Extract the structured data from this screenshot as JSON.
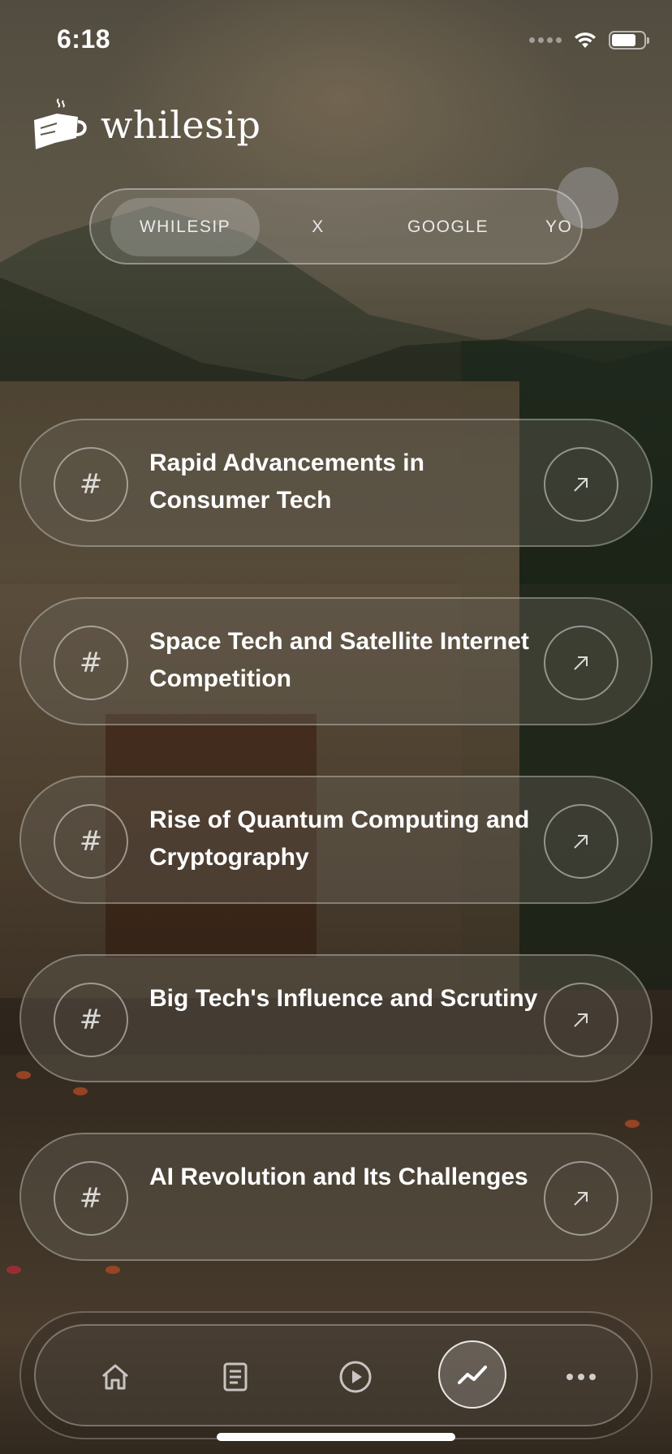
{
  "status_bar": {
    "time": "6:18",
    "battery_level": 0.75
  },
  "app": {
    "name": "whilesip"
  },
  "source_tabs": [
    {
      "label": "WHILESIP",
      "active": true
    },
    {
      "label": "X",
      "active": false
    },
    {
      "label": "GOOGLE",
      "active": false
    },
    {
      "label": "YO",
      "active": false
    }
  ],
  "topics": [
    {
      "title": "Rapid Advancements in Consumer Tech",
      "icon": "hash-icon",
      "action_icon": "arrow-up-right-icon"
    },
    {
      "title": "Space Tech and Satellite Internet Competition",
      "icon": "hash-icon",
      "action_icon": "arrow-up-right-icon"
    },
    {
      "title": "Rise of Quantum Computing and Cryptography",
      "icon": "hash-icon",
      "action_icon": "arrow-up-right-icon"
    },
    {
      "title": "Big Tech's Influence and Scrutiny",
      "icon": "hash-icon",
      "action_icon": "arrow-up-right-icon"
    },
    {
      "title": "AI Revolution and Its Challenges",
      "icon": "hash-icon",
      "action_icon": "arrow-up-right-icon"
    }
  ],
  "hash_symbol": "#",
  "bottom_nav": [
    {
      "icon": "home-icon",
      "active": false
    },
    {
      "icon": "document-icon",
      "active": false
    },
    {
      "icon": "play-icon",
      "active": false
    },
    {
      "icon": "trending-icon",
      "active": true
    },
    {
      "icon": "more-icon",
      "active": false
    }
  ],
  "colors": {
    "text": "#ffffff",
    "card_border": "rgba(255,255,255,0.3)"
  }
}
